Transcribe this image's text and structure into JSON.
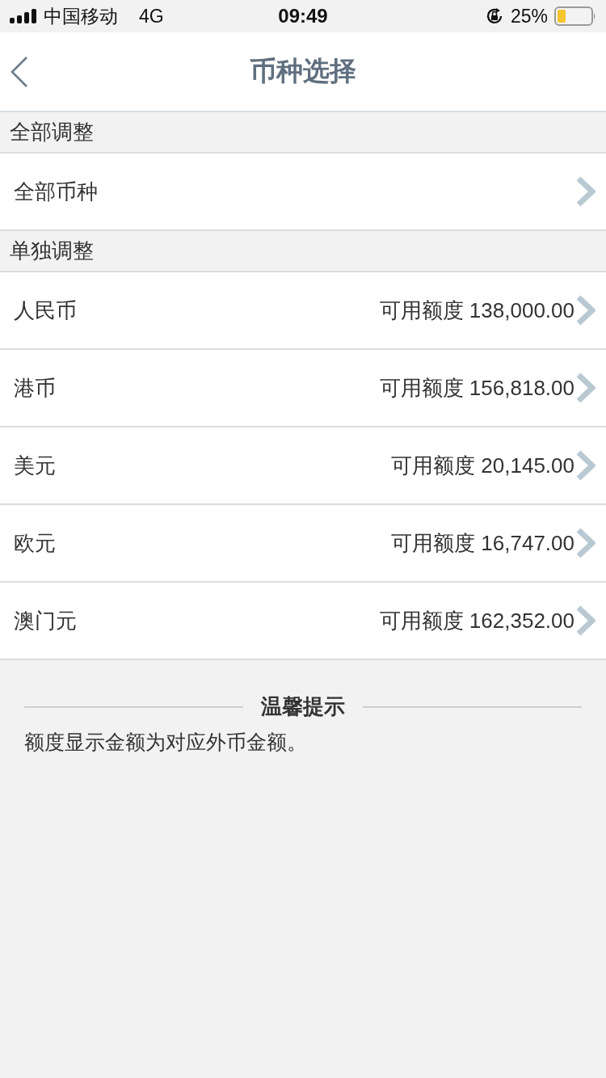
{
  "status_bar": {
    "carrier": "中国移动",
    "network": "4G",
    "time": "09:49",
    "battery": "25%"
  },
  "nav": {
    "title": "币种选择"
  },
  "sections": [
    {
      "header": "全部调整",
      "rows": [
        {
          "label": "全部币种"
        }
      ]
    },
    {
      "header": "单独调整",
      "rows": [
        {
          "label": "人民币",
          "detail": "可用额度 138,000.00"
        },
        {
          "label": "港币",
          "detail": "可用额度 156,818.00"
        },
        {
          "label": "美元",
          "detail": "可用额度 20,145.00"
        },
        {
          "label": "欧元",
          "detail": "可用额度 16,747.00"
        },
        {
          "label": "澳门元",
          "detail": "可用额度 162,352.00"
        }
      ]
    }
  ],
  "tip": {
    "title": "温馨提示",
    "text": "额度显示金额为对应外币金额。"
  }
}
